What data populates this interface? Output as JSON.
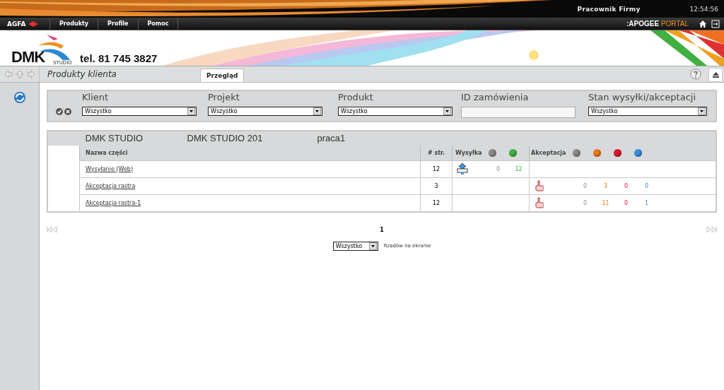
{
  "top_bar": {
    "user": "Pracownik Firmy",
    "time": "12:54:56"
  },
  "nav": {
    "brand": "AGFA",
    "items": [
      "Produkty",
      "Profile",
      "Pomoc"
    ],
    "portal": {
      "prefix": ":APOGEE",
      "suffix": "PORTAL"
    }
  },
  "banner": {
    "logo": "DMK",
    "logo_sub": "STUDIO",
    "phone": "tel. 81 745 3827"
  },
  "page": {
    "title": "Produkty klienta",
    "tabs": [
      {
        "label": "Przegląd",
        "selected": true
      }
    ]
  },
  "filters": [
    {
      "label": "Klient",
      "kind": "select",
      "value": "Wszystko"
    },
    {
      "label": "Projekt",
      "kind": "select",
      "value": "Wszystko"
    },
    {
      "label": "Produkt",
      "kind": "select",
      "value": "Wszystko"
    },
    {
      "label": "ID zamówienia",
      "kind": "text"
    },
    {
      "label": "Stan wysyłki/akceptacji",
      "kind": "select",
      "value": "Wszystko"
    }
  ],
  "result": {
    "client": "DMK STUDIO",
    "project": "DMK STUDIO 201",
    "product": "praca1",
    "columns": {
      "name": "Nazwa części",
      "pages": "# str.",
      "send": "Wysyłka",
      "accept": "Akceptacja"
    },
    "send_statuses": [
      {
        "color": "#8a8a8a"
      },
      {
        "color": "#3cb83c"
      }
    ],
    "accept_statuses": [
      {
        "color": "#8a8a8a"
      },
      {
        "color": "#f07818"
      },
      {
        "color": "#e01828"
      },
      {
        "color": "#3a8ee0"
      }
    ],
    "rows": [
      {
        "name": "Wysyłanie (Web)",
        "pages": "12",
        "send": [
          "0",
          "12"
        ]
      },
      {
        "name": "Akceptacja rastra",
        "pages": "3",
        "accept": [
          "0",
          "3",
          "0",
          "0"
        ]
      },
      {
        "name": "Akceptacja rastra-1",
        "pages": "12",
        "accept": [
          "0",
          "11",
          "0",
          "1"
        ]
      }
    ]
  },
  "pagination": {
    "current": "1",
    "rows_select": "Wszystko",
    "rows_label": "Rzędów na ekranie"
  }
}
